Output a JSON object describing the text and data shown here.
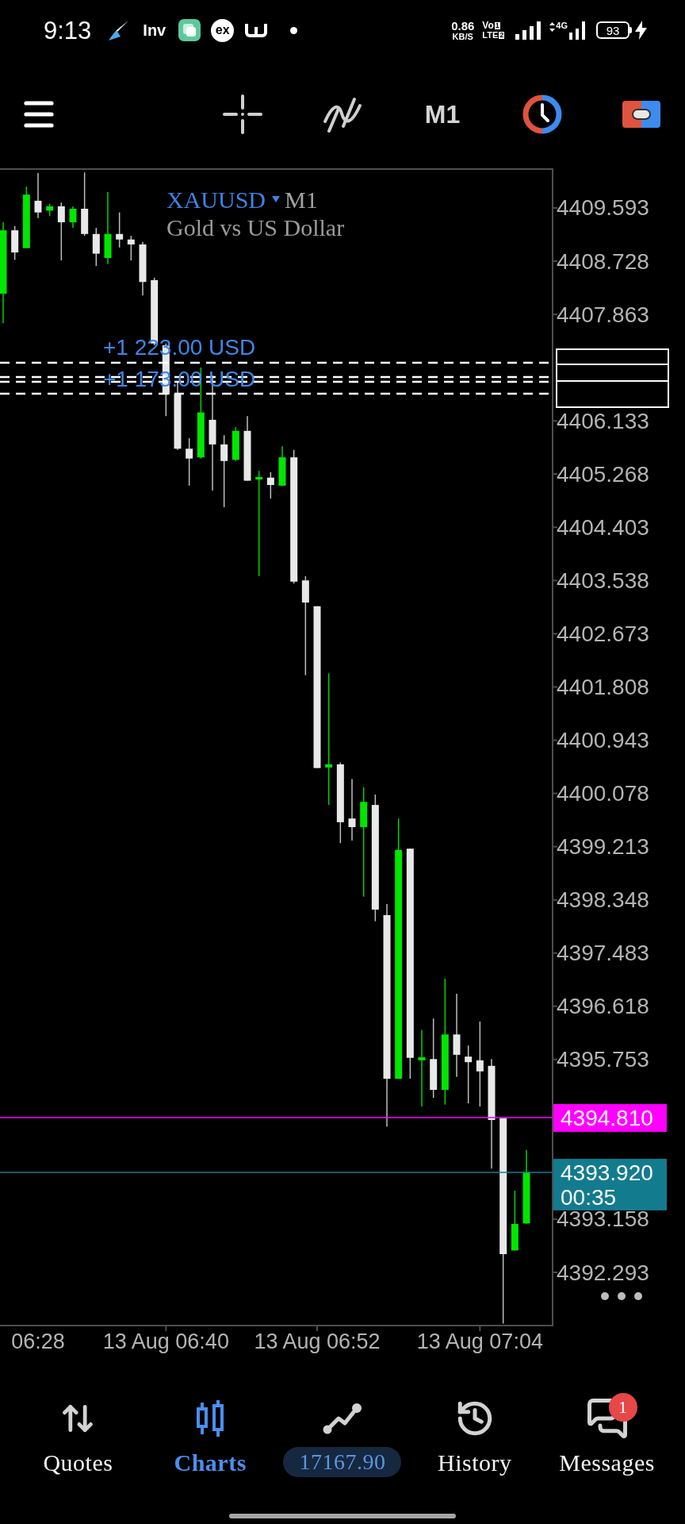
{
  "status_bar": {
    "time": "9:13",
    "app_labels": [
      "Inv",
      "ex"
    ],
    "net_speed": "0.86",
    "net_unit": "KB/S",
    "volte": "Vo",
    "volte_sim": "1",
    "lte": "LTE",
    "lte_sim": "2",
    "network": "4G",
    "battery": "93"
  },
  "toolbar": {
    "timeframe": "M1"
  },
  "chart": {
    "symbol": "XAUUSD",
    "timeframe": "M1",
    "description": "Gold vs US Dollar",
    "profit_labels": [
      "+1 223.00 USD",
      "+1 173.00 USD"
    ],
    "price_tags": [
      {
        "price": "4394.810"
      },
      {
        "price": "4393.920",
        "timer": "00:35"
      }
    ],
    "chart_data": {
      "type": "candlestick",
      "categories": [
        null,
        null,
        null,
        "06:28",
        null,
        null,
        null,
        null,
        null,
        null,
        null,
        null,
        null,
        null,
        "13 Aug 06:40",
        null,
        null,
        null,
        null,
        null,
        null,
        null,
        null,
        null,
        null,
        null,
        null,
        "13 Aug 06:52",
        null,
        null,
        null,
        null,
        null,
        null,
        null,
        null,
        null,
        null,
        null,
        null,
        null,
        "13 Aug 07:04",
        null,
        null,
        null,
        null
      ],
      "ohlc": [
        [
          4408.2,
          4409.36,
          4407.72,
          4409.23
        ],
        [
          4409.23,
          4409.3,
          4408.75,
          4408.87
        ],
        [
          4408.94,
          4409.94,
          4408.94,
          4409.81
        ],
        [
          4409.71,
          4410.16,
          4409.43,
          4409.52
        ],
        [
          4409.55,
          4409.66,
          4409.46,
          4409.62
        ],
        [
          4409.62,
          4409.68,
          4408.74,
          4409.36
        ],
        [
          4409.36,
          4409.62,
          4409.27,
          4409.58
        ],
        [
          4409.58,
          4410.17,
          4409.14,
          4409.17
        ],
        [
          4409.17,
          4409.27,
          4408.65,
          4408.85
        ],
        [
          4408.78,
          4409.85,
          4408.68,
          4409.17
        ],
        [
          4409.17,
          4409.52,
          4408.95,
          4409.08
        ],
        [
          4409.08,
          4409.14,
          4408.74,
          4409.0
        ],
        [
          4409.0,
          4409.04,
          4408.17,
          4408.39
        ],
        [
          4408.42,
          4408.46,
          4407.36,
          4407.39
        ],
        [
          4407.36,
          4407.39,
          4406.21,
          4406.56
        ],
        [
          4406.57,
          4406.76,
          4405.66,
          4405.68
        ],
        [
          4405.68,
          4405.85,
          4405.08,
          4405.52
        ],
        [
          4405.54,
          4407.0,
          4405.52,
          4406.27
        ],
        [
          4406.15,
          4406.87,
          4405.0,
          4405.75
        ],
        [
          4405.75,
          4405.9,
          4404.73,
          4405.48
        ],
        [
          4405.5,
          4406.03,
          4405.48,
          4405.97
        ],
        [
          4405.97,
          4406.21,
          4405.16,
          4405.16
        ],
        [
          4405.18,
          4405.32,
          4403.61,
          4405.22
        ],
        [
          4405.21,
          4405.3,
          4404.87,
          4405.09
        ],
        [
          4405.08,
          4405.72,
          4405.07,
          4405.54
        ],
        [
          4405.54,
          4405.66,
          4403.49,
          4403.52
        ],
        [
          4403.54,
          4403.61,
          4402.0,
          4403.18
        ],
        [
          4403.12,
          4403.12,
          4400.49,
          4400.49
        ],
        [
          4400.5,
          4402.03,
          4399.89,
          4400.55
        ],
        [
          4400.55,
          4400.58,
          4399.27,
          4399.61
        ],
        [
          4399.67,
          4400.31,
          4399.31,
          4399.53
        ],
        [
          4399.53,
          4400.18,
          4398.4,
          4399.94
        ],
        [
          4399.89,
          4400.06,
          4398.0,
          4398.19
        ],
        [
          4398.1,
          4398.28,
          4394.66,
          4395.44
        ],
        [
          4395.44,
          4399.67,
          4395.44,
          4399.16
        ],
        [
          4399.18,
          4399.18,
          4395.44,
          4395.78
        ],
        [
          4395.74,
          4396.23,
          4394.99,
          4395.79
        ],
        [
          4395.76,
          4396.42,
          4395.13,
          4395.26
        ],
        [
          4395.26,
          4397.07,
          4395.02,
          4396.16
        ],
        [
          4396.16,
          4396.82,
          4395.47,
          4395.83
        ],
        [
          4395.8,
          4395.98,
          4395.04,
          4395.71
        ],
        [
          4395.74,
          4396.37,
          4394.99,
          4395.56
        ],
        [
          4395.65,
          4395.76,
          4393.98,
          4394.77
        ],
        [
          4394.8,
          4394.8,
          4391.46,
          4392.59
        ],
        [
          4392.65,
          4393.62,
          4392.65,
          4393.08
        ],
        [
          4393.09,
          4394.28,
          4393.08,
          4393.92
        ]
      ],
      "ylim": [
        4391.429,
        4410.225
      ],
      "yticks": [
        {
          "value": 4409.593,
          "label": "4409.593"
        },
        {
          "value": 4408.728,
          "label": "4408.728"
        },
        {
          "value": 4407.863,
          "label": "4407.863"
        },
        {
          "value": 4406.133,
          "label": "4406.133"
        },
        {
          "value": 4405.268,
          "label": "4405.268"
        },
        {
          "value": 4404.403,
          "label": "4404.403"
        },
        {
          "value": 4403.538,
          "label": "4403.538"
        },
        {
          "value": 4402.673,
          "label": "4402.673"
        },
        {
          "value": 4401.808,
          "label": "4401.808"
        },
        {
          "value": 4400.943,
          "label": "4400.943"
        },
        {
          "value": 4400.078,
          "label": "4400.078"
        },
        {
          "value": 4399.213,
          "label": "4399.213"
        },
        {
          "value": 4398.348,
          "label": "4398.348"
        },
        {
          "value": 4397.483,
          "label": "4397.483"
        },
        {
          "value": 4396.618,
          "label": "4396.618"
        },
        {
          "value": 4395.753,
          "label": "4395.753"
        },
        {
          "value": 4393.158,
          "label": "4393.158"
        },
        {
          "value": 4392.293,
          "label": "4392.293"
        }
      ],
      "ref_lines": [
        {
          "axis": "y",
          "value": 4394.81,
          "color": "#ff00ff"
        },
        {
          "axis": "y",
          "value": 4393.92,
          "color": "#137b8e"
        }
      ]
    }
  },
  "nav": {
    "items": [
      {
        "kind": "tab",
        "label": "Quotes",
        "selected": false
      },
      {
        "kind": "tab",
        "label": "Charts",
        "selected": true
      },
      {
        "kind": "balance",
        "label": "17167.90",
        "selected": false
      },
      {
        "kind": "tab",
        "label": "History",
        "selected": false
      },
      {
        "kind": "tab",
        "label": "Messages",
        "selected": false,
        "badge": "1"
      }
    ]
  }
}
